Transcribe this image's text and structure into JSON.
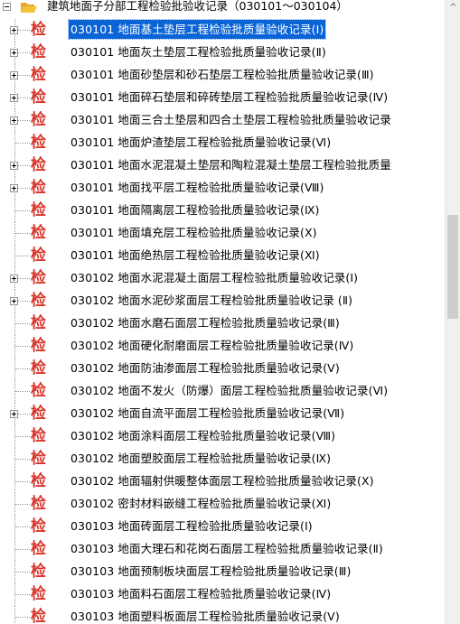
{
  "root": {
    "label": "建筑地面子分部工程检验批验收记录（030101～030104）",
    "expanded": true,
    "icon": "folder-open-icon"
  },
  "colors": {
    "selection": "#0a64d6",
    "jian_icon": "#d9352b",
    "folder": "#f5c23c"
  },
  "item_icon_glyph": "检",
  "items": [
    {
      "code": "030101",
      "title": "地面基土垫层工程检验批质量验收记录(Ⅰ)",
      "has_children": true,
      "selected": true
    },
    {
      "code": "030101",
      "title": "地面灰土垫层工程检验批质量验收记录(Ⅱ)",
      "has_children": true,
      "selected": false
    },
    {
      "code": "030101",
      "title": "地面砂垫层和砂石垫层工程检验批质量验收记录(Ⅲ)",
      "has_children": true,
      "selected": false
    },
    {
      "code": "030101",
      "title": "地面碎石垫层和碎砖垫层工程检验批质量验收记录(Ⅳ)",
      "has_children": true,
      "selected": false
    },
    {
      "code": "030101",
      "title": "地面三合土垫层和四合土垫层工程检验批质量验收记录",
      "has_children": true,
      "selected": false
    },
    {
      "code": "030101",
      "title": "地面炉渣垫层工程检验批质量验收记录(Ⅵ)",
      "has_children": false,
      "selected": false
    },
    {
      "code": "030101",
      "title": "地面水泥混凝土垫层和陶粒混凝土垫层工程检验批质量",
      "has_children": true,
      "selected": false
    },
    {
      "code": "030101",
      "title": "地面找平层工程检验批质量验收记录(Ⅷ)",
      "has_children": true,
      "selected": false
    },
    {
      "code": "030101",
      "title": "地面隔离层工程检验批质量验收记录(Ⅸ)",
      "has_children": false,
      "selected": false
    },
    {
      "code": "030101",
      "title": "地面填充层工程检验批质量验收记录(Ⅹ)",
      "has_children": false,
      "selected": false
    },
    {
      "code": "030101",
      "title": "地面绝热层工程检验批质量验收记录(Ⅺ)",
      "has_children": false,
      "selected": false
    },
    {
      "code": "030102",
      "title": "地面水泥混凝土面层工程检验批质量验收记录(Ⅰ)",
      "has_children": true,
      "selected": false
    },
    {
      "code": "030102",
      "title": "地面水泥砂浆面层工程检验批质量验收记录 (Ⅱ)",
      "has_children": true,
      "selected": false
    },
    {
      "code": "030102",
      "title": "地面水磨石面层工程检验批质量验收记录(Ⅲ)",
      "has_children": false,
      "selected": false
    },
    {
      "code": "030102",
      "title": "地面硬化耐磨面层工程检验批质量验收记录(Ⅳ)",
      "has_children": false,
      "selected": false
    },
    {
      "code": "030102",
      "title": "地面防油渗面层工程检验批质量验收记录(Ⅴ)",
      "has_children": false,
      "selected": false
    },
    {
      "code": "030102",
      "title": "地面不发火（防爆）面层工程检验批质量验收记录(Ⅵ)",
      "has_children": false,
      "selected": false
    },
    {
      "code": "030102",
      "title": "地面自流平面层工程检验批质量验收记录(Ⅶ)",
      "has_children": true,
      "selected": false
    },
    {
      "code": "030102",
      "title": "地面涂料面层工程检验批质量验收记录(Ⅷ)",
      "has_children": false,
      "selected": false
    },
    {
      "code": "030102",
      "title": "地面塑胶面层工程检验批质量验收记录(Ⅸ)",
      "has_children": false,
      "selected": false
    },
    {
      "code": "030102",
      "title": "地面辐射供暖整体面层工程检验批质量验收记录(Ⅹ)",
      "has_children": false,
      "selected": false
    },
    {
      "code": "030102",
      "title": "密封材料嵌缝工程检验批质量验收记录(Ⅺ)",
      "has_children": false,
      "selected": false
    },
    {
      "code": "030103",
      "title": "地面砖面层工程检验批质量验收记录(Ⅰ)",
      "has_children": false,
      "selected": false
    },
    {
      "code": "030103",
      "title": "地面大理石和花岗石面层工程检验批质量验收记录(Ⅱ)",
      "has_children": false,
      "selected": false
    },
    {
      "code": "030103",
      "title": "地面预制板块面层工程检验批质量验收记录(Ⅲ)",
      "has_children": false,
      "selected": false
    },
    {
      "code": "030103",
      "title": "地面料石面层工程检验批质量验收记录(Ⅳ)",
      "has_children": false,
      "selected": false
    },
    {
      "code": "030103",
      "title": "地面塑料板面层工程检验批质量验收记录(Ⅴ)",
      "has_children": false,
      "selected": false
    }
  ],
  "scrollbar": {
    "up_arrow": "^",
    "scroll_position": 0.35
  }
}
